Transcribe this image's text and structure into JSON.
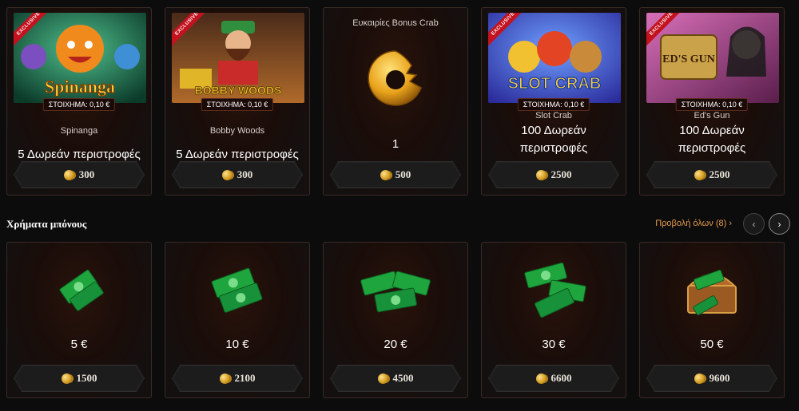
{
  "featured": [
    {
      "badge": "EXCLUSIVE",
      "stake": "ΣΤΟΙΧΗΜΑ: 0,10 €",
      "game": "Spinanga",
      "prize": "5 Δωρεάν περιστροφές",
      "price": "300",
      "art_text": "Spinanga",
      "accent": "#2e7d3b"
    },
    {
      "badge": "EXCLUSIVE",
      "stake": "ΣΤΟΙΧΗΜΑ: 0,10 €",
      "game": "Bobby Woods",
      "prize": "5 Δωρεάν περιστροφές",
      "price": "300",
      "art_text": "BOBBY WOODS",
      "accent": "#7aa43a"
    },
    {
      "title": "Ευκαιρίες Bonus Crab",
      "prize": "1",
      "price": "500"
    },
    {
      "badge": "EXCLUSIVE",
      "stake": "ΣΤΟΙΧΗΜΑ: 0,10 €",
      "game": "Slot Crab",
      "prize": "100 Δωρεάν περιστροφές",
      "price": "2500",
      "art_text": "SLOT CRAB",
      "accent": "#3c56c9"
    },
    {
      "badge": "EXCLUSIVE",
      "stake": "ΣΤΟΙΧΗΜΑ: 0,10 €",
      "game": "Ed's Gun",
      "prize": "100 Δωρεάν περιστροφές",
      "price": "2500",
      "art_text": "ED'S GUN",
      "accent": "#8a3a78"
    }
  ],
  "section": {
    "title": "Χρήματα μπόνους",
    "view_all": "Προβολή όλων (8)",
    "view_all_arrow": "›"
  },
  "nav": {
    "prev": "‹",
    "next": "›"
  },
  "bonus_cash": [
    {
      "amount": "5 €",
      "price": "1500"
    },
    {
      "amount": "10 €",
      "price": "2100"
    },
    {
      "amount": "20 €",
      "price": "4500"
    },
    {
      "amount": "30 €",
      "price": "6600"
    },
    {
      "amount": "50 €",
      "price": "9600"
    }
  ],
  "colors": {
    "accent_orange": "#e59b4d",
    "badge_red": "#c4121f",
    "cash_green": "#1fa53d"
  }
}
